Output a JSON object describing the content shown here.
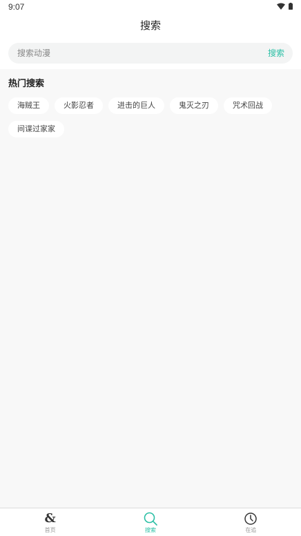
{
  "status_bar": {
    "time": "9:07",
    "wifi_icon": "wifi-icon",
    "battery_icon": "battery-icon"
  },
  "header": {
    "title": "搜索"
  },
  "search": {
    "placeholder": "搜索动漫",
    "value": "",
    "button_label": "搜索"
  },
  "hot_search": {
    "title": "热门搜索",
    "tags": [
      "海贼王",
      "火影忍者",
      "进击的巨人",
      "鬼灭之刃",
      "咒术回战",
      "间谍过家家"
    ]
  },
  "bottom_nav": {
    "items": [
      {
        "label": "首页",
        "icon": "home-icon",
        "active": false
      },
      {
        "label": "搜索",
        "icon": "search-icon",
        "active": true
      },
      {
        "label": "在追",
        "icon": "clock-icon",
        "active": false
      }
    ]
  },
  "colors": {
    "accent": "#2bbfa5",
    "background": "#f8f8f8",
    "surface": "#ffffff",
    "search_bg": "#f3f4f4"
  }
}
